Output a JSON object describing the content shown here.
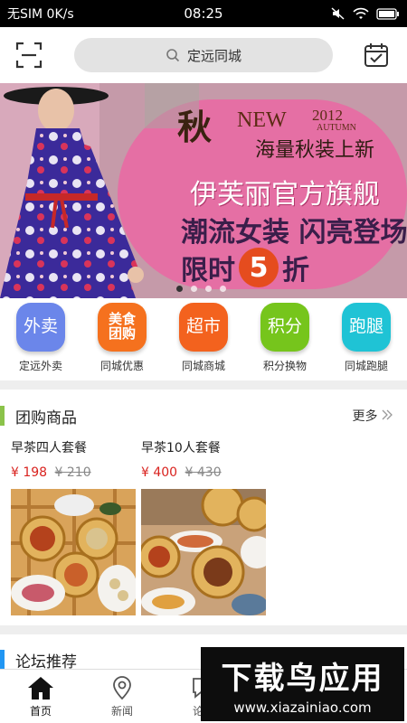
{
  "status": {
    "carrier": "无SIM 0K/s",
    "time": "08:25"
  },
  "search": {
    "placeholder": "定远同城"
  },
  "banner": {
    "season": "秋",
    "new_text": "NEW",
    "year": "2012",
    "autumn": "AUTUMN",
    "line1": "海量秋装上新",
    "line2": "伊芙丽官方旗舰",
    "line3": "潮流女装 闪亮登场",
    "line4_pre": "限时",
    "line4_num": "5",
    "line4_post": "折"
  },
  "categories": [
    {
      "icon": "外卖",
      "label": "定远外卖",
      "color": "#6b86ea"
    },
    {
      "icon": "美食\n团购",
      "label": "同城优惠",
      "color": "#f5711e"
    },
    {
      "icon": "超市",
      "label": "同城商城",
      "color": "#f3621e"
    },
    {
      "icon": "积分",
      "label": "积分换物",
      "color": "#76c51c"
    },
    {
      "icon": "跑腿",
      "label": "同城跑腿",
      "color": "#1fc3d5"
    }
  ],
  "group": {
    "title": "团购商品",
    "more": "更多",
    "products": [
      {
        "name": "早茶四人套餐",
        "price": "¥ 198",
        "old": "¥ 210"
      },
      {
        "name": "早茶10人套餐",
        "price": "¥ 400",
        "old": "¥ 430"
      }
    ]
  },
  "forum": {
    "title": "论坛推荐"
  },
  "tabs": [
    {
      "label": "首页"
    },
    {
      "label": "新闻"
    },
    {
      "label": "论坛"
    }
  ],
  "watermark": {
    "big": "下载鸟应用",
    "small": "www.xiazainiao.com"
  }
}
